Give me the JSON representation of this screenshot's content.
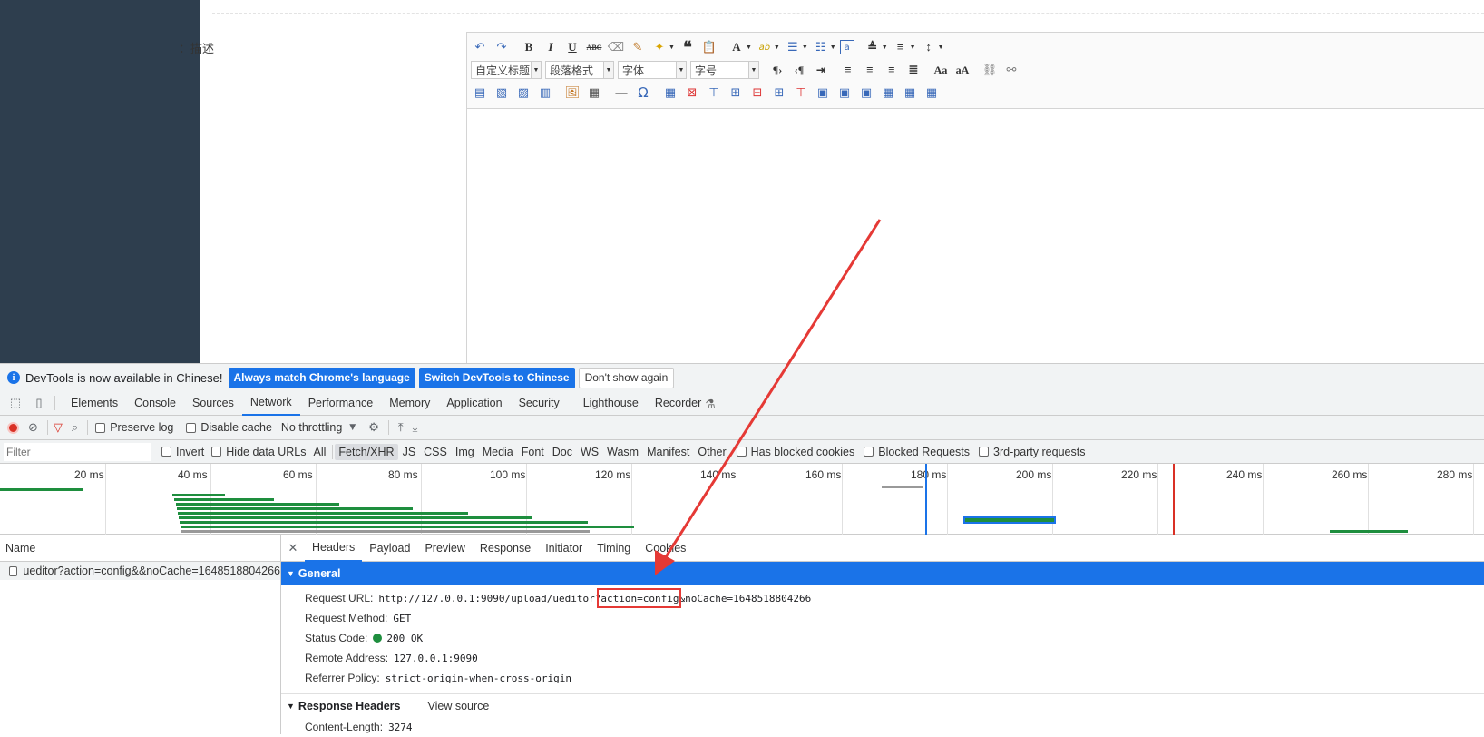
{
  "page": {
    "description_label": "描述："
  },
  "editor": {
    "combos": {
      "custom_title": "自定义标题",
      "paragraph": "段落格式",
      "font_family": "字体",
      "font_size": "字号"
    },
    "toolbar_icons": {
      "undo": "undo-icon",
      "redo": "redo-icon",
      "bold": "bold-icon",
      "italic": "italic-icon",
      "underline": "underline-icon",
      "strikethrough": "strikethrough-icon",
      "eraser": "eraser-icon",
      "format_brush": "format-brush-icon",
      "autotypeset": "autotypeset-icon",
      "blockquote": "blockquote-icon",
      "paste_plain": "paste-plain-icon",
      "forecolor": "forecolor-icon",
      "backcolor": "backcolor-icon",
      "ordered_list": "ordered-list-icon",
      "unordered_list": "unordered-list-icon",
      "select_all": "select-all-icon",
      "link": "link-icon",
      "unlink": "unlink-icon",
      "horizontal": "horizontal-rule-icon",
      "special_chars": "special-chars-icon"
    },
    "glyphs": {
      "bold": "B",
      "italic": "I",
      "underline": "U",
      "strike": "ABC",
      "font_color": "A",
      "omega": "Ω",
      "quote": "❝"
    }
  },
  "devtools": {
    "banner": {
      "text": "DevTools is now available in Chinese!",
      "btn_match": "Always match Chrome's language",
      "btn_switch": "Switch DevTools to Chinese",
      "btn_dismiss": "Don't show again"
    },
    "tabs": [
      "Elements",
      "Console",
      "Sources",
      "Network",
      "Performance",
      "Memory",
      "Application",
      "Security",
      "Lighthouse",
      "Recorder"
    ],
    "network_toolbar": {
      "preserve_log": "Preserve log",
      "disable_cache": "Disable cache",
      "throttling": "No throttling"
    },
    "filter_bar": {
      "placeholder": "Filter",
      "invert": "Invert",
      "hide_data_urls": "Hide data URLs",
      "types": [
        "All",
        "Fetch/XHR",
        "JS",
        "CSS",
        "Img",
        "Media",
        "Font",
        "Doc",
        "WS",
        "Wasm",
        "Manifest",
        "Other"
      ],
      "selected_type": "Fetch/XHR",
      "has_blocked_cookies": "Has blocked cookies",
      "blocked_requests": "Blocked Requests",
      "third_party": "3rd-party requests"
    },
    "overview_ticks": [
      "20 ms",
      "40 ms",
      "60 ms",
      "80 ms",
      "100 ms",
      "120 ms",
      "140 ms",
      "160 ms",
      "180 ms",
      "200 ms",
      "220 ms",
      "240 ms",
      "260 ms",
      "280 ms"
    ],
    "request_list": {
      "header": "Name",
      "request_name": "ueditor?action=config&&noCache=1648518804266"
    },
    "detail_tabs": [
      "Headers",
      "Payload",
      "Preview",
      "Response",
      "Initiator",
      "Timing",
      "Cookies"
    ],
    "general": {
      "title": "General",
      "request_url_key": "Request URL:",
      "request_url_prefix": "http://127.0.0.1:9090/upload/ueditor?",
      "request_url_highlight": "action=config",
      "request_url_suffix": "&noCache=1648518804266",
      "method_key": "Request Method:",
      "method_val": "GET",
      "status_key": "Status Code:",
      "status_val": "200 OK",
      "remote_key": "Remote Address:",
      "remote_val": "127.0.0.1:9090",
      "referrer_key": "Referrer Policy:",
      "referrer_val": "strict-origin-when-cross-origin"
    },
    "response_headers": {
      "title": "Response Headers",
      "view_source": "View source",
      "content_length_key": "Content-Length:",
      "content_length_val": "3274"
    }
  },
  "colors": {
    "sidebar": "#2e3e4e",
    "accent": "#1a73e8",
    "annotation": "#e53935",
    "status_ok": "#1e8e3e"
  }
}
